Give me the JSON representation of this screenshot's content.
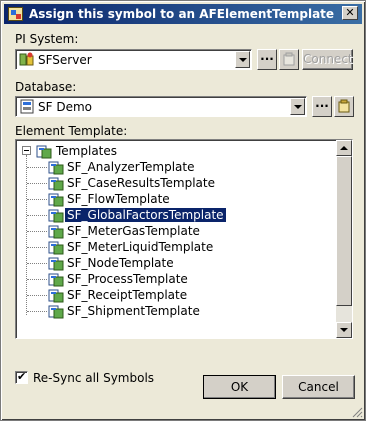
{
  "window": {
    "title": "Assign this symbol to an AFElementTemplate",
    "close_glyph": "✕"
  },
  "pi_system": {
    "label": "PI System:",
    "value": "SFServer",
    "icon": "server-icon",
    "browse_label": "...",
    "connect_label": "Connect"
  },
  "database": {
    "label": "Database:",
    "value": "SF Demo",
    "icon": "database-icon",
    "browse_label": "..."
  },
  "element_template": {
    "label": "Element Template:",
    "root": "Templates",
    "items": [
      "SF_AnalyzerTemplate",
      "SF_CaseResultsTemplate",
      "SF_FlowTemplate",
      "SF_GlobalFactorsTemplate",
      "SF_MeterGasTemplate",
      "SF_MeterLiquidTemplate",
      "SF_NodeTemplate",
      "SF_ProcessTemplate",
      "SF_ReceiptTemplate",
      "SF_ShipmentTemplate"
    ],
    "selected": "SF_GlobalFactorsTemplate"
  },
  "resync": {
    "label": "Re-Sync all Symbols",
    "checked": true,
    "check_glyph": "✔"
  },
  "buttons": {
    "ok": "OK",
    "cancel": "Cancel"
  },
  "colors": {
    "dialog_bg": "#ece9d8",
    "title_bar": "#0a246a",
    "selection": "#0a246a"
  }
}
